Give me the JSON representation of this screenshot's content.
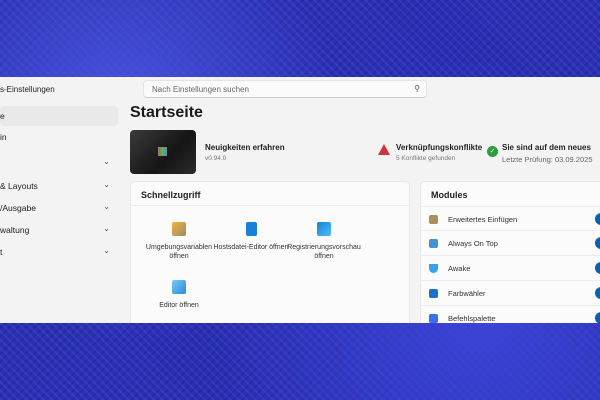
{
  "window": {
    "title": "s-Einstellungen"
  },
  "search": {
    "placeholder": "Nach Einstellungen suchen",
    "icon": "search-icon"
  },
  "sidebar": {
    "items": [
      {
        "label": "e",
        "selected": true
      },
      {
        "label": "in"
      },
      {
        "label": "",
        "expandable": true
      },
      {
        "label": "& Layouts",
        "expandable": true
      },
      {
        "label": "/Ausgabe",
        "expandable": true
      },
      {
        "label": "waltung",
        "expandable": true
      },
      {
        "label": "t",
        "expandable": true
      }
    ]
  },
  "page": {
    "title": "Startseite"
  },
  "news": {
    "title": "Neuigkeiten erfahren",
    "version": "v0.94.0"
  },
  "conflicts": {
    "title": "Verknüpfungskonflikte",
    "subtitle": "5 Konflikte gefunden",
    "color": "#d13438"
  },
  "update": {
    "title": "Sie sind auf dem neues",
    "subtitle": "Letzte Prüfung:  03.09.2025",
    "color": "#2e9e3a"
  },
  "quick": {
    "title": "Schnellzugriff",
    "items": [
      {
        "label": "Umgebungsvariablen öffnen"
      },
      {
        "label": "Hostsdatei-Editor öffnen"
      },
      {
        "label": "Registrierungsvorschau öffnen"
      },
      {
        "label": "Editor öffnen"
      }
    ]
  },
  "modules": {
    "title": "Modules",
    "items": [
      {
        "label": "Erweitertes Einfügen",
        "enabled": true
      },
      {
        "label": "Always On Top",
        "enabled": true
      },
      {
        "label": "Awake",
        "enabled": true
      },
      {
        "label": "Farbwähler",
        "enabled": true
      },
      {
        "label": "Befehlspalette",
        "enabled": true
      }
    ]
  },
  "accent": "#0a5fb4"
}
